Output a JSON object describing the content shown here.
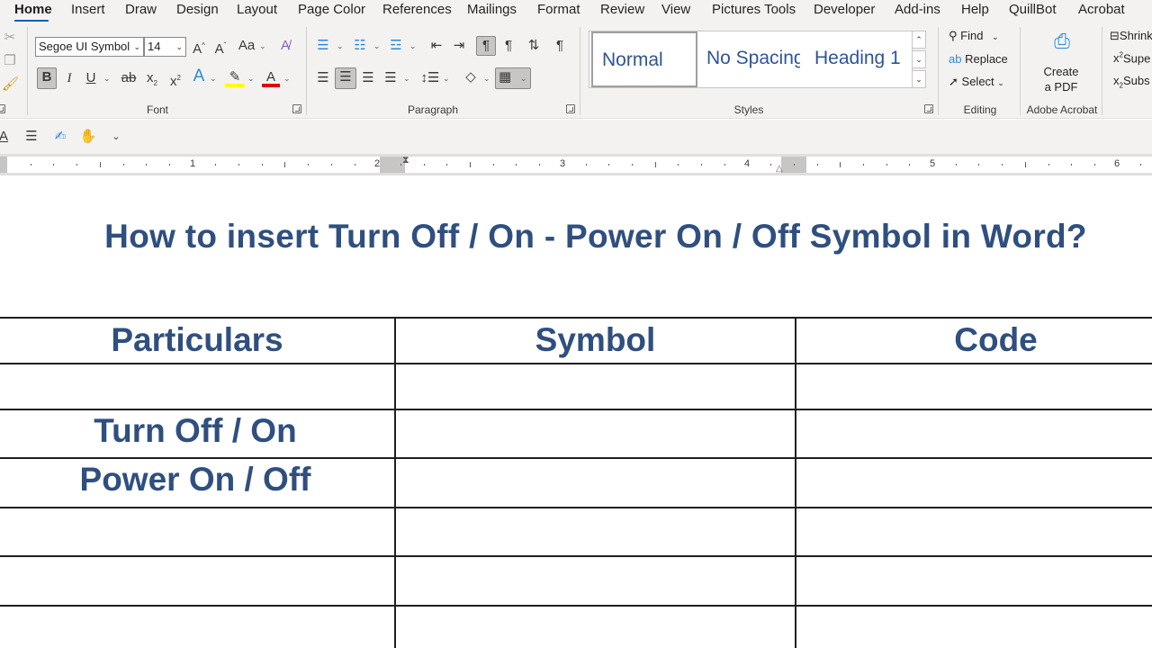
{
  "tabs": [
    "Home",
    "Insert",
    "Draw",
    "Design",
    "Layout",
    "Page Color",
    "References",
    "Mailings",
    "Format",
    "Review",
    "View",
    "Pictures Tools",
    "Developer",
    "Add-ins",
    "Help",
    "QuillBot",
    "Acrobat"
  ],
  "font": {
    "name": "Segoe UI Symbol",
    "size": "14",
    "group_label": "Font"
  },
  "paragraph": {
    "group_label": "Paragraph"
  },
  "styles": {
    "items": [
      "Normal",
      "No Spacing",
      "Heading 1"
    ],
    "group_label": "Styles"
  },
  "editing": {
    "find": "Find",
    "replace": "Replace",
    "select": "Select",
    "group_label": "Editing"
  },
  "acrobat": {
    "create_line1": "Create",
    "create_line2": "a PDF",
    "group_label": "Adobe Acrobat"
  },
  "extra": {
    "shrink": "Shrink",
    "superscript": "Supe",
    "subscript": "Subs"
  },
  "ruler": {
    "numbers": [
      "1",
      "2",
      "3",
      "4",
      "5",
      "6"
    ]
  },
  "document": {
    "title": "How to insert Turn Off / On - Power On / Off Symbol in Word?",
    "table": {
      "headers": [
        "Particulars",
        "Symbol",
        "Code"
      ],
      "rows": [
        [
          "",
          "",
          ""
        ],
        [
          "Turn Off / On",
          "",
          ""
        ],
        [
          "Power On / Off",
          "",
          ""
        ],
        [
          "",
          "",
          ""
        ],
        [
          "",
          "",
          ""
        ],
        [
          "",
          "",
          ""
        ]
      ]
    }
  },
  "colors": {
    "accent": "#185abd",
    "heading": "#2f4f7f",
    "ribbon_bg": "#f3f2f1"
  }
}
